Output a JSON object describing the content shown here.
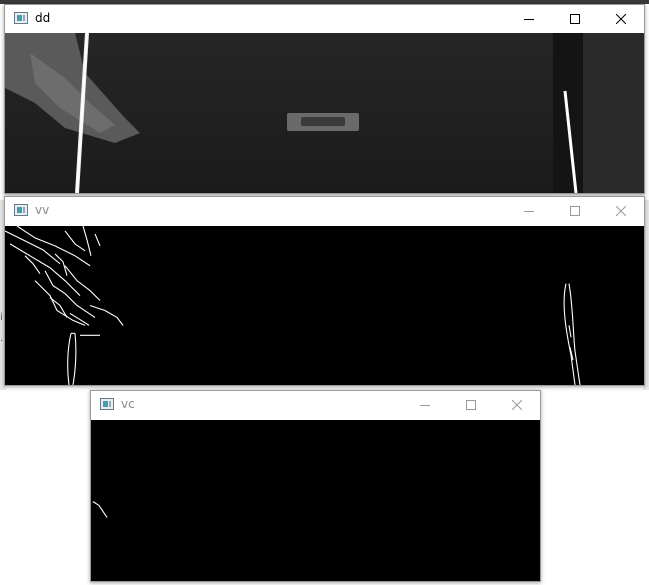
{
  "windows": [
    {
      "id": "dd",
      "title": "dd",
      "active": true
    },
    {
      "id": "vv",
      "title": "vv",
      "active": false
    },
    {
      "id": "vc",
      "title": "vc",
      "active": false
    }
  ],
  "desktop_marks": [
    "i",
    "·"
  ],
  "colors": {
    "titlebar": "#ffffff",
    "edge_background": "#000000",
    "edge_lines": "#ffffff",
    "inactive_title_text": "#8a8a8a"
  },
  "icons": {
    "app": "window-app-icon",
    "minimize": "minimize-icon",
    "maximize": "maximize-icon",
    "close": "close-icon"
  }
}
